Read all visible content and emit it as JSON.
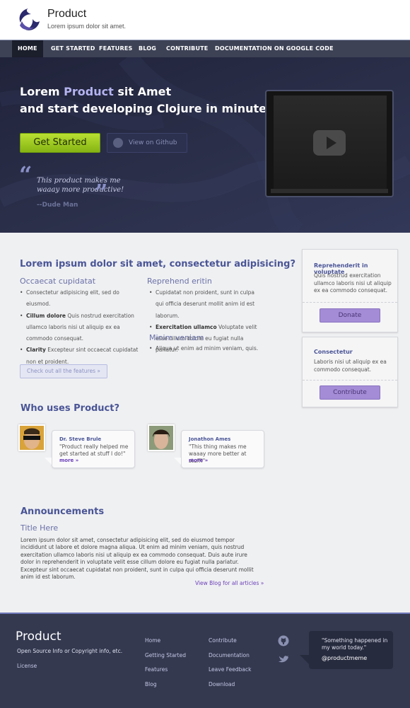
{
  "header": {
    "title": "Product",
    "tagline": "Lorem ipsum dolor sit amet."
  },
  "nav": {
    "items": [
      "HOME",
      "GET STARTED",
      "FEATURES",
      "BLOG",
      "CONTRIBUTE",
      "DOCUMENTATION ON GOOGLE CODE"
    ],
    "active": "HOME"
  },
  "hero": {
    "headline_pre": "Lorem ",
    "headline_accent": "Product",
    "headline_post": " sit Amet",
    "headline_line2": "and start developing Clojure in minutes!",
    "start_button": "Get Started",
    "github_button": "View on Github",
    "quote": "This product makes me waaay more productive!",
    "quote_author": "--Dude Man"
  },
  "features": {
    "heading": "Lorem ipsum dolor sit amet, consectetur adipisicing?",
    "col1_title": "Occaecat cupidatat",
    "col1_items": [
      {
        "bold": "",
        "text": "Consectetur adipisicing elit, sed do eiusmod."
      },
      {
        "bold": "Cillum dolore",
        "text": " Quis nostrud exercitation ullamco laboris nisi ut aliquip ex ea commodo consequat."
      },
      {
        "bold": "Clarity",
        "text": " Excepteur sint occaecat cupidatat non et proident."
      }
    ],
    "col2_title": "Reprehend eritin",
    "col2_items": [
      {
        "bold": "",
        "text": "Cupidatat non proident, sunt in culpa qui officia deserunt mollit anim id est laborum."
      },
      {
        "bold": "Exercitation ullamco",
        "text": " Voluptate velit esse cillum dolore eu fugiat nulla pariatur."
      }
    ],
    "col2b_title": "Minim veniam",
    "col2b_items": [
      {
        "bold": "",
        "text": "Aliqua ut enim ad minim veniam, quis."
      }
    ],
    "button": "Check out all the features »"
  },
  "sidebar": {
    "box1": {
      "title": "Reprehenderit in voluptate",
      "text": "Quis nostrud exercitation ullamco laboris nisi ut aliquip ex ea commodo consequat.",
      "button": "Donate"
    },
    "box2": {
      "title": "Consectetur",
      "text": "Laboris nisi ut aliquip ex ea commodo consequat.",
      "button": "Contribute"
    }
  },
  "who_uses": {
    "heading": "Who uses Product?",
    "testimonials": [
      {
        "name": "Dr. Steve Brule",
        "quote": "\"Product really helped me get started at stuff I do!\"",
        "more": "more »"
      },
      {
        "name": "Jonathon Ames",
        "quote": "\"This thing makes me waaay more better at stuff!\"",
        "more": "more »"
      }
    ]
  },
  "announcements": {
    "heading": "Announcements",
    "title": "Title Here",
    "body": "Lorem ipsum dolor sit amet, consectetur adipisicing elit, sed do eiusmod tempor incididunt ut labore et dolore magna aliqua. Ut enim ad minim veniam, quis nostrud exercitation ullamco laboris nisi ut aliquip ex ea commodo consequat. Duis aute irure dolor in reprehenderit in voluptate velit esse cillum dolore eu fugiat nulla pariatur. Excepteur sint occaecat cupidatat non proident, sunt in culpa qui officia deserunt mollit anim id est laborum.",
    "link": "View Blog for all articles »"
  },
  "footer": {
    "title": "Product",
    "info": "Open Source Info or Copyright info, etc.",
    "license": "License",
    "links_col1": [
      "Home",
      "Getting Started",
      "Features",
      "Blog"
    ],
    "links_col2": [
      "Contribute",
      "Documentation",
      "Leave Feedback",
      "Download"
    ],
    "tweet": "\"Something happened in my world today.\"",
    "handle": "@productmeme"
  },
  "colors": {
    "accent": "#4a5596",
    "nav_bg": "#3d4255",
    "hero_bg": "#2a2e48",
    "cta_green": "#9ccb22",
    "purple_button": "#a48cd6",
    "footer_bg": "#343950"
  }
}
